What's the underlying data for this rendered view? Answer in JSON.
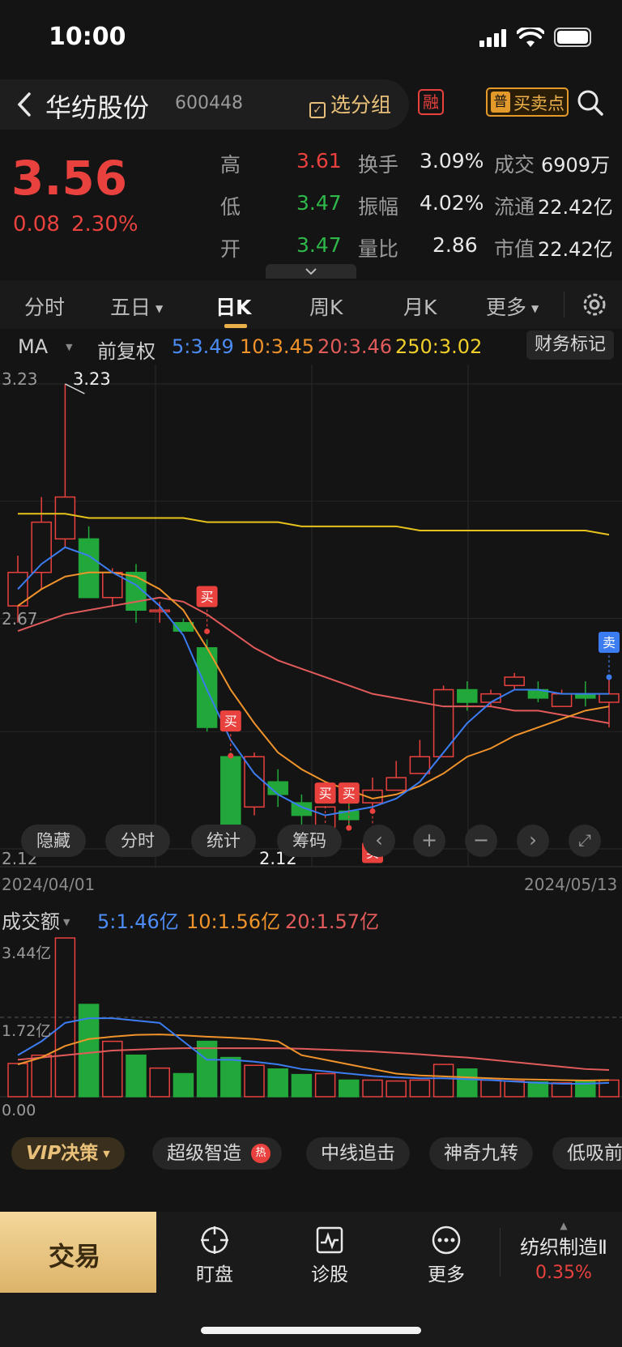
{
  "status": {
    "time": "10:00"
  },
  "stock": {
    "name": "华纺股份",
    "code": "600448",
    "group_btn": "选分组",
    "margin_tag": "融",
    "signal_tag": "普",
    "signal_btn": "买卖点"
  },
  "quote": {
    "price": "3.56",
    "change": "0.08",
    "change_pct": "2.30%",
    "high_label": "高",
    "high": "3.61",
    "low_label": "低",
    "low": "3.47",
    "open_label": "开",
    "open": "3.47",
    "turnover_label": "换手",
    "turnover": "3.09%",
    "amplitude_label": "振幅",
    "amplitude": "4.02%",
    "vol_ratio_label": "量比",
    "vol_ratio": "2.86",
    "amount_label": "成交",
    "amount": "6909万",
    "float_label": "流通",
    "float_cap": "22.42亿",
    "mktcap_label": "市值",
    "mkt_cap": "22.42亿"
  },
  "tabs": [
    "分时",
    "五日",
    "日K",
    "周K",
    "月K",
    "更多"
  ],
  "active_tab": "日K",
  "ma": {
    "label": "MA",
    "adjust": "前复权",
    "ma5": "5:3.49",
    "ma10": "10:3.45",
    "ma20": "20:3.46",
    "ma250": "250:3.02",
    "finance_btn": "财务标记"
  },
  "kchart": {
    "y_high": "3.23",
    "y_mid": "2.67",
    "y_low": "2.12",
    "max_label": "3.23",
    "min_label": "2.12",
    "date_start": "2024/04/01",
    "date_end": "2024/05/13",
    "buy": "买",
    "sell": "卖",
    "overlay": [
      "隐藏",
      "分时",
      "统计",
      "筹码"
    ],
    "colors": {
      "ma5": "#3b7cf0",
      "ma10": "#f0932b",
      "ma20": "#e25b5b",
      "ma250": "#e8c21c",
      "up": "#e8413e",
      "down": "#22a83a"
    }
  },
  "volume": {
    "label": "成交额",
    "ma5": "5:1.46亿",
    "ma10": "10:1.56亿",
    "ma20": "20:1.57亿",
    "y_top": "3.44亿",
    "y_mid": "1.72亿",
    "y_zero": "0.00"
  },
  "strategy": {
    "vip": "VIP",
    "vip_label": "决策",
    "items": [
      "超级智造",
      "中线追击",
      "神奇九转",
      "低吸前"
    ],
    "hot": "热"
  },
  "bottom": {
    "trade": "交易",
    "watch": "盯盘",
    "diagnose": "诊股",
    "more": "更多",
    "sector": "纺织制造Ⅱ",
    "sector_pct": "0.35%"
  },
  "chart_data": {
    "type": "candlestick",
    "title": "",
    "x_start": "2024/04/01",
    "x_end": "2024/05/13",
    "ylim": [
      2.12,
      3.23
    ],
    "candles": [
      {
        "o": 2.7,
        "c": 2.78,
        "h": 2.82,
        "l": 2.66
      },
      {
        "o": 2.78,
        "c": 2.9,
        "h": 2.96,
        "l": 2.74
      },
      {
        "o": 2.86,
        "c": 2.96,
        "h": 3.23,
        "l": 2.84
      },
      {
        "o": 2.86,
        "c": 2.72,
        "h": 2.89,
        "l": 2.72
      },
      {
        "o": 2.72,
        "c": 2.78,
        "h": 2.79,
        "l": 2.7
      },
      {
        "o": 2.78,
        "c": 2.69,
        "h": 2.8,
        "l": 2.66
      },
      {
        "o": 2.69,
        "c": 2.69,
        "h": 2.71,
        "l": 2.66
      },
      {
        "o": 2.66,
        "c": 2.64,
        "h": 2.67,
        "l": 2.64
      },
      {
        "o": 2.6,
        "c": 2.41,
        "h": 2.62,
        "l": 2.4
      },
      {
        "o": 2.34,
        "c": 2.17,
        "h": 2.35,
        "l": 2.17
      },
      {
        "o": 2.22,
        "c": 2.34,
        "h": 2.35,
        "l": 2.2
      },
      {
        "o": 2.28,
        "c": 2.25,
        "h": 2.31,
        "l": 2.22
      },
      {
        "o": 2.23,
        "c": 2.2,
        "h": 2.25,
        "l": 2.12
      },
      {
        "o": 2.17,
        "c": 2.22,
        "h": 2.22,
        "l": 2.17
      },
      {
        "o": 2.21,
        "c": 2.19,
        "h": 2.24,
        "l": 2.17
      },
      {
        "o": 2.23,
        "c": 2.26,
        "h": 2.29,
        "l": 2.21
      },
      {
        "o": 2.26,
        "c": 2.29,
        "h": 2.33,
        "l": 2.26
      },
      {
        "o": 2.3,
        "c": 2.34,
        "h": 2.38,
        "l": 2.3
      },
      {
        "o": 2.34,
        "c": 2.5,
        "h": 2.51,
        "l": 2.34
      },
      {
        "o": 2.5,
        "c": 2.47,
        "h": 2.52,
        "l": 2.45
      },
      {
        "o": 2.47,
        "c": 2.49,
        "h": 2.5,
        "l": 2.46
      },
      {
        "o": 2.51,
        "c": 2.53,
        "h": 2.54,
        "l": 2.5
      },
      {
        "o": 2.5,
        "c": 2.48,
        "h": 2.52,
        "l": 2.47
      },
      {
        "o": 2.46,
        "c": 2.49,
        "h": 2.5,
        "l": 2.46
      },
      {
        "o": 2.49,
        "c": 2.48,
        "h": 2.52,
        "l": 2.46
      },
      {
        "o": 2.47,
        "c": 2.49,
        "h": 2.53,
        "l": 2.41
      }
    ],
    "ma5": [
      2.74,
      2.8,
      2.84,
      2.82,
      2.78,
      2.75,
      2.7,
      2.63,
      2.5,
      2.38,
      2.3,
      2.25,
      2.22,
      2.2,
      2.21,
      2.22,
      2.24,
      2.28,
      2.35,
      2.42,
      2.47,
      2.5,
      2.5,
      2.49,
      2.49,
      2.49
    ],
    "ma10": [
      2.7,
      2.74,
      2.77,
      2.78,
      2.78,
      2.77,
      2.74,
      2.69,
      2.6,
      2.5,
      2.42,
      2.35,
      2.31,
      2.28,
      2.26,
      2.24,
      2.25,
      2.27,
      2.3,
      2.34,
      2.36,
      2.39,
      2.41,
      2.43,
      2.45,
      2.46
    ],
    "ma20": [
      2.64,
      2.66,
      2.68,
      2.69,
      2.7,
      2.71,
      2.72,
      2.71,
      2.68,
      2.64,
      2.6,
      2.57,
      2.55,
      2.53,
      2.51,
      2.49,
      2.48,
      2.47,
      2.46,
      2.46,
      2.46,
      2.45,
      2.45,
      2.44,
      2.43,
      2.42
    ],
    "ma250": [
      2.92,
      2.92,
      2.92,
      2.91,
      2.91,
      2.91,
      2.91,
      2.91,
      2.9,
      2.9,
      2.9,
      2.9,
      2.89,
      2.89,
      2.89,
      2.89,
      2.89,
      2.88,
      2.88,
      2.88,
      2.88,
      2.88,
      2.88,
      2.88,
      2.88,
      2.87
    ],
    "volume": [
      0.72,
      0.9,
      3.44,
      2.0,
      1.2,
      0.9,
      0.62,
      0.5,
      1.2,
      0.85,
      0.68,
      0.6,
      0.48,
      0.5,
      0.36,
      0.36,
      0.34,
      0.36,
      0.7,
      0.6,
      0.36,
      0.34,
      0.32,
      0.3,
      0.33,
      0.36
    ],
    "vol_ma5": [
      0.9,
      1.2,
      1.6,
      1.7,
      1.7,
      1.65,
      1.6,
      1.2,
      0.8,
      0.8,
      0.76,
      0.7,
      0.6,
      0.55,
      0.5,
      0.45,
      0.42,
      0.4,
      0.4,
      0.38,
      0.36,
      0.33,
      0.3,
      0.28,
      0.28,
      0.3
    ],
    "vol_ma10": [
      0.7,
      0.85,
      1.1,
      1.25,
      1.3,
      1.34,
      1.35,
      1.33,
      1.3,
      1.28,
      1.25,
      1.2,
      0.9,
      0.8,
      0.7,
      0.6,
      0.5,
      0.46,
      0.44,
      0.42,
      0.4,
      0.38,
      0.37,
      0.36,
      0.35,
      0.36
    ],
    "vol_ma20": [
      0.8,
      0.85,
      0.9,
      0.95,
      1.0,
      1.02,
      1.04,
      1.05,
      1.05,
      1.05,
      1.05,
      1.05,
      1.04,
      1.02,
      1.0,
      0.98,
      0.95,
      0.92,
      0.88,
      0.85,
      0.8,
      0.75,
      0.7,
      0.65,
      0.6,
      0.58
    ],
    "signals": [
      {
        "i": 8,
        "type": "买"
      },
      {
        "i": 9,
        "type": "买"
      },
      {
        "i": 13,
        "type": "买"
      },
      {
        "i": 14,
        "type": "买"
      },
      {
        "i": 15,
        "type": "买"
      },
      {
        "i": 25,
        "type": "卖"
      }
    ]
  }
}
